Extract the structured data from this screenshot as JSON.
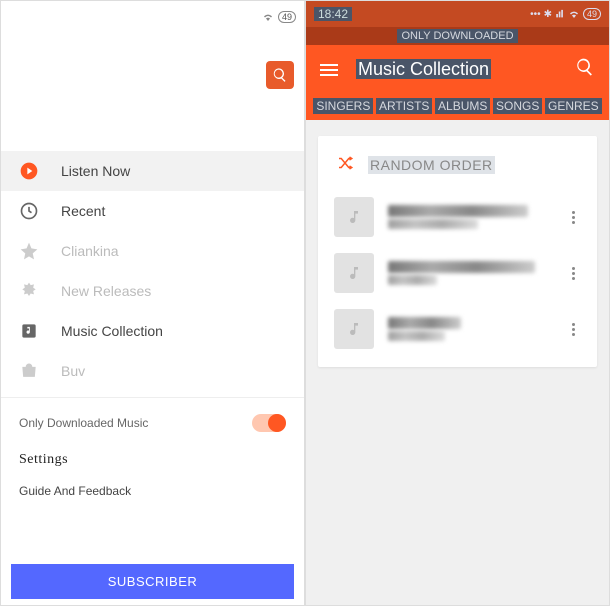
{
  "left": {
    "status": {
      "battery": "49"
    },
    "nav": [
      {
        "icon": "listen-now",
        "label": "Listen Now",
        "state": "active"
      },
      {
        "icon": "recent",
        "label": "Recent",
        "state": "normal"
      },
      {
        "icon": "star",
        "label": "Cliankina",
        "state": "disabled"
      },
      {
        "icon": "new",
        "label": "New Releases",
        "state": "disabled"
      },
      {
        "icon": "library",
        "label": "Music Collection",
        "state": "normal"
      },
      {
        "icon": "buy",
        "label": "Buv",
        "state": "disabled"
      }
    ],
    "only_downloaded_label": "Only Downloaded Music",
    "only_downloaded_on": true,
    "settings_label": "Settings",
    "feedback_label": "Guide And Feedback",
    "subscriber_label": "SUBSCRIBER"
  },
  "right": {
    "status": {
      "time": "18:42",
      "battery": "49"
    },
    "only_downloaded_banner": "ONLY DOWNLOADED",
    "app_title": "Music Collection",
    "tabs": [
      "SINGERS",
      "ARTISTS",
      "ALBUMS",
      "SONGS",
      "GENRES"
    ],
    "random_label": "RANDOM ORDER",
    "tracks": [
      {
        "title_w": "86%",
        "sub_w": "55%"
      },
      {
        "title_w": "90%",
        "sub_w": "30%"
      },
      {
        "title_w": "45%",
        "sub_w": "35%"
      }
    ]
  },
  "colors": {
    "accent": "#ff5722",
    "subscriber": "#5468ff"
  }
}
